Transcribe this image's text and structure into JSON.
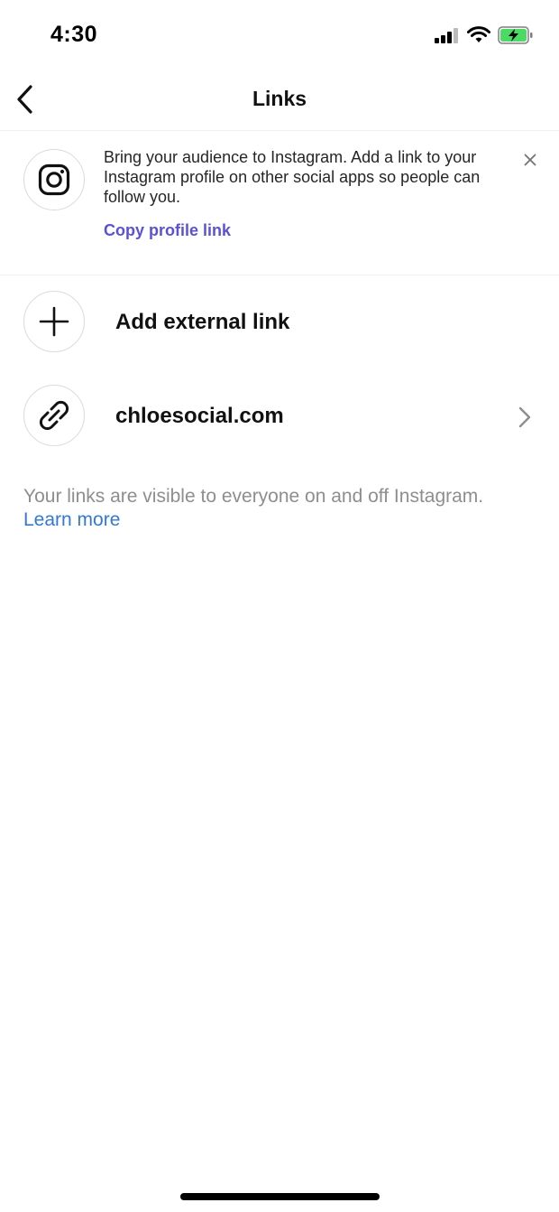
{
  "status_bar": {
    "time": "4:30",
    "icons": [
      "cellular-signal-icon",
      "wifi-icon",
      "battery-charging-icon"
    ],
    "battery_color": "#4cd964"
  },
  "header": {
    "title": "Links",
    "back_icon": "chevron-left-icon"
  },
  "promo": {
    "icon": "instagram-logo-icon",
    "text": "Bring your audience to Instagram. Add a link to your Instagram profile on other social apps so people can follow you.",
    "action_label": "Copy profile link",
    "close_icon": "close-icon",
    "action_color": "#5b51d8"
  },
  "links": {
    "add_label": "Add external link",
    "add_icon": "plus-icon",
    "items": [
      {
        "label": "chloesocial.com",
        "icon": "link-icon",
        "chevron": "chevron-right-icon"
      }
    ]
  },
  "footer": {
    "note": "Your links are visible to everyone on and off Instagram.",
    "learn_more": "Learn more",
    "link_color": "#3478d6"
  }
}
